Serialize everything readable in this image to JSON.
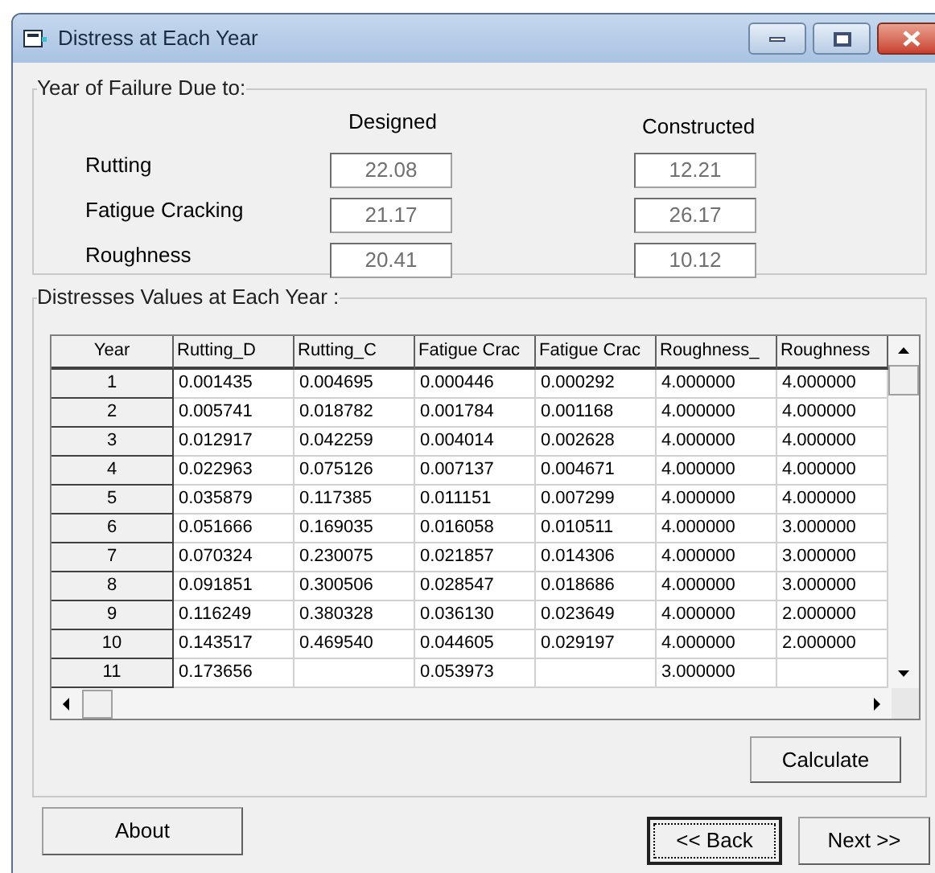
{
  "window": {
    "title": "Distress at Each Year"
  },
  "failure_group": {
    "title": "Year of Failure Due to:",
    "columns": [
      "Designed",
      "Constructed"
    ],
    "rows": [
      {
        "label": "Rutting",
        "designed": "22.08",
        "constructed": "12.21"
      },
      {
        "label": "Fatigue Cracking",
        "designed": "21.17",
        "constructed": "26.17"
      },
      {
        "label": "Roughness",
        "designed": "20.41",
        "constructed": "10.12"
      }
    ]
  },
  "values_group": {
    "title": "Distresses Values at Each Year :",
    "table": {
      "columns": [
        "Year",
        "Rutting_D",
        "Rutting_C",
        "Fatigue Crac",
        "Fatigue Crac",
        "Roughness_",
        "Roughness"
      ],
      "rows": [
        [
          "1",
          "0.001435",
          "0.004695",
          "0.000446",
          "0.000292",
          "4.000000",
          "4.000000"
        ],
        [
          "2",
          "0.005741",
          "0.018782",
          "0.001784",
          "0.001168",
          "4.000000",
          "4.000000"
        ],
        [
          "3",
          "0.012917",
          "0.042259",
          "0.004014",
          "0.002628",
          "4.000000",
          "4.000000"
        ],
        [
          "4",
          "0.022963",
          "0.075126",
          "0.007137",
          "0.004671",
          "4.000000",
          "4.000000"
        ],
        [
          "5",
          "0.035879",
          "0.117385",
          "0.011151",
          "0.007299",
          "4.000000",
          "4.000000"
        ],
        [
          "6",
          "0.051666",
          "0.169035",
          "0.016058",
          "0.010511",
          "4.000000",
          "3.000000"
        ],
        [
          "7",
          "0.070324",
          "0.230075",
          "0.021857",
          "0.014306",
          "4.000000",
          "3.000000"
        ],
        [
          "8",
          "0.091851",
          "0.300506",
          "0.028547",
          "0.018686",
          "4.000000",
          "3.000000"
        ],
        [
          "9",
          "0.116249",
          "0.380328",
          "0.036130",
          "0.023649",
          "4.000000",
          "2.000000"
        ],
        [
          "10",
          "0.143517",
          "0.469540",
          "0.044605",
          "0.029197",
          "4.000000",
          "2.000000"
        ],
        [
          "11",
          "0.173656",
          null,
          "0.053973",
          null,
          "3.000000",
          null
        ]
      ]
    },
    "calculate_button": "Calculate"
  },
  "buttons": [
    {
      "label": "About",
      "focused": false
    },
    {
      "label": "<< Back",
      "focused": true
    },
    {
      "label": "Next >>",
      "focused": false
    }
  ]
}
